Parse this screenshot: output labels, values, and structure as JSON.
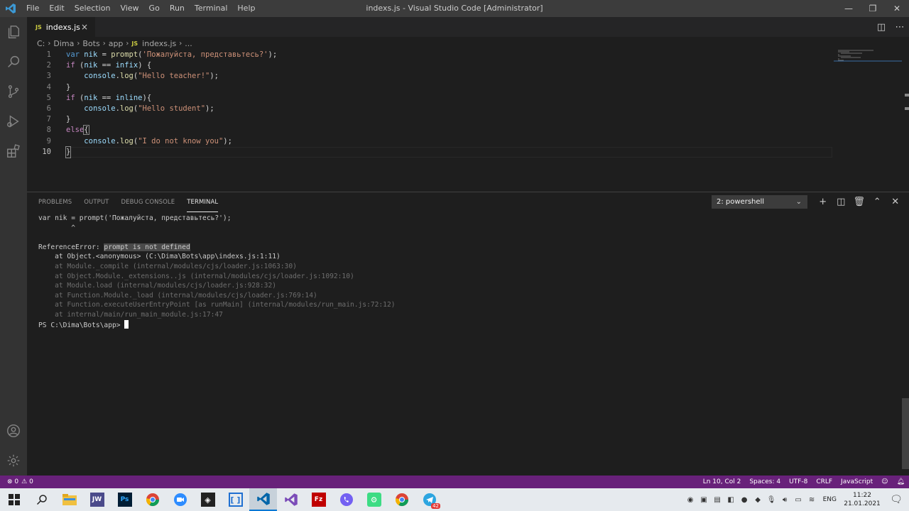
{
  "titlebar": {
    "menu": [
      "File",
      "Edit",
      "Selection",
      "View",
      "Go",
      "Run",
      "Terminal",
      "Help"
    ],
    "title": "indexs.js - Visual Studio Code [Administrator]"
  },
  "tab": {
    "badge": "JS",
    "name": "indexs.js",
    "close": "×"
  },
  "breadcrumb": [
    "C:",
    "Dima",
    "Bots",
    "app",
    "indexs.js",
    "..."
  ],
  "editor": {
    "lines": [
      {
        "n": "1"
      },
      {
        "n": "2"
      },
      {
        "n": "3"
      },
      {
        "n": "4"
      },
      {
        "n": "5"
      },
      {
        "n": "6"
      },
      {
        "n": "7"
      },
      {
        "n": "8"
      },
      {
        "n": "9"
      },
      {
        "n": "10"
      }
    ],
    "code": {
      "l1_kw": "var",
      "l1_var": "nik",
      "l1_eq": " = ",
      "l1_fn": "prompt",
      "l1_open": "(",
      "l1_str": "'Пожалуйста, представьтесь?'",
      "l1_close": ");",
      "l2_kw": "if",
      "l2_rest_a": " (",
      "l2_var": "nik",
      "l2_op": " == ",
      "l2_var2": "infix",
      "l2_rest_b": ") {",
      "l3_obj": "console",
      "l3_dot": ".",
      "l3_fn": "log",
      "l3_open": "(",
      "l3_str": "\"Hello teacher!\"",
      "l3_close": ");",
      "l4": "}",
      "l5_kw": "if",
      "l5_rest_a": " (",
      "l5_var": "nik",
      "l5_op": " == ",
      "l5_var2": "inline",
      "l5_rest_b": "){",
      "l6_obj": "console",
      "l6_dot": ".",
      "l6_fn": "log",
      "l6_open": "(",
      "l6_str": "\"Hello student\"",
      "l6_close": ");",
      "l7": "}",
      "l8_kw": "else",
      "l8_brace": "{",
      "l9_obj": "console",
      "l9_dot": ".",
      "l9_fn": "log",
      "l9_open": "(",
      "l9_str": "\"I do not know you\"",
      "l9_close": ");",
      "l10": "}"
    }
  },
  "panel": {
    "tabs": [
      "PROBLEMS",
      "OUTPUT",
      "DEBUG CONSOLE",
      "TERMINAL"
    ],
    "terminal_select": "2: powershell",
    "terminal": {
      "l1": "var nik = prompt('Пожалуйста, представьтесь?');",
      "l2": "        ^",
      "err_prefix": "ReferenceError: ",
      "err_msg": "prompt is not defined",
      "at1": "    at Object.<anonymous> (C:\\Dima\\Bots\\app\\indexs.js:1:11)",
      "at2": "    at Module._compile (internal/modules/cjs/loader.js:1063:30)",
      "at3": "    at Object.Module._extensions..js (internal/modules/cjs/loader.js:1092:10)",
      "at4": "    at Module.load (internal/modules/cjs/loader.js:928:32)",
      "at5": "    at Function.Module._load (internal/modules/cjs/loader.js:769:14)",
      "at6": "    at Function.executeUserEntryPoint [as runMain] (internal/modules/run_main.js:72:12)",
      "at7": "    at internal/main/run_main_module.js:17:47",
      "prompt": "PS C:\\Dima\\Bots\\app> "
    }
  },
  "status": {
    "errors": "⊗ 0",
    "warnings": "⚠ 0",
    "position": "Ln 10, Col 2",
    "spaces": "Spaces: 4",
    "encoding": "UTF-8",
    "eol": "CRLF",
    "language": "JavaScript"
  },
  "taskbar": {
    "lang": "ENG",
    "time": "11:22",
    "date": "21.01.2021",
    "jw": "JW",
    "ps": "Ps",
    "fz": "Fz",
    "tg_badge": "42"
  },
  "colors": {
    "statusbar": "#68217a",
    "accent": "#0078d4"
  }
}
